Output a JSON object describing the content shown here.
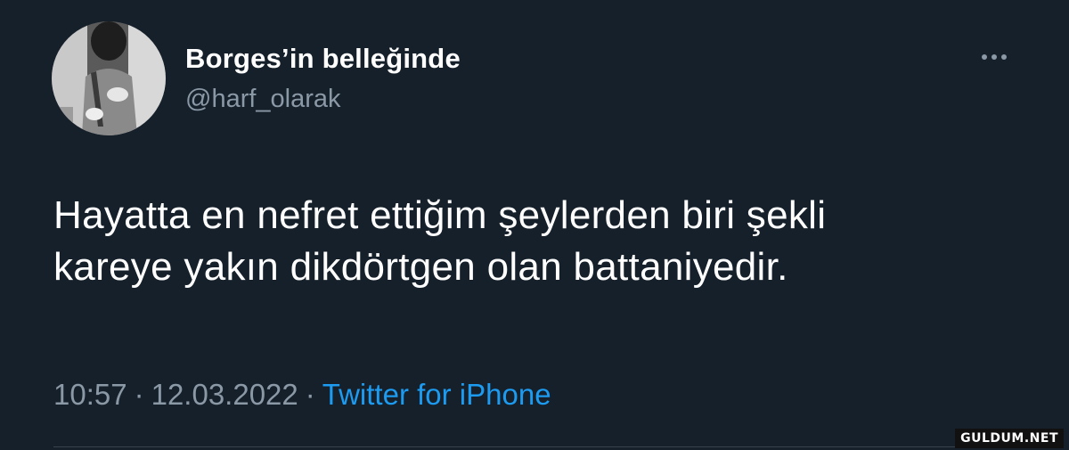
{
  "author": {
    "display_name": "Borges’in belleğinde",
    "handle": "@harf_olarak"
  },
  "tweet": {
    "lines": [
      "Hayatta en nefret ettiğim şeylerden biri şekli",
      "kareye yakın dikdörtgen olan battaniyedir."
    ]
  },
  "meta": {
    "time": "10:57",
    "separator": "·",
    "date": "12.03.2022",
    "source": "Twitter for iPhone"
  },
  "icons": {
    "more": "more-horizontal-icon",
    "avatar": "profile-photo"
  },
  "colors": {
    "background": "#15202b",
    "text_primary": "#ffffff",
    "text_secondary": "#8b98a5",
    "link": "#1d9bf0",
    "divider": "#38444d"
  },
  "watermark": {
    "text": "GULDUM.NET"
  }
}
